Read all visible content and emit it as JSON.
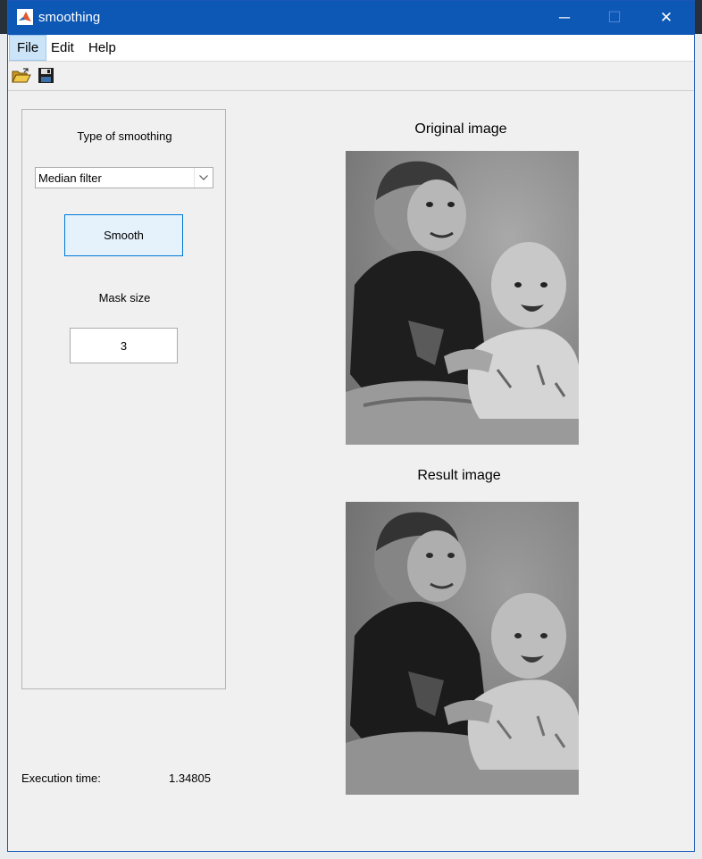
{
  "window": {
    "title": "smoothing"
  },
  "titlebar_buttons": {
    "minimize": "─",
    "maximize": "☐",
    "close": "✕"
  },
  "menu": {
    "items": [
      "File",
      "Edit",
      "Help"
    ]
  },
  "toolbar": {
    "icons": [
      "open-folder-icon",
      "save-icon"
    ]
  },
  "panel": {
    "type_label": "Type of smoothing",
    "filter_selected": "Median filter",
    "smooth_button": "Smooth",
    "mask_label": "Mask size",
    "mask_value": "3"
  },
  "execution": {
    "label": "Execution time:",
    "value": "1.34805"
  },
  "images": {
    "original_title": "Original image",
    "result_title": "Result image"
  },
  "colors": {
    "titlebar": "#0d57b5",
    "accent": "#0078d7",
    "window_bg": "#f0f0f0"
  }
}
